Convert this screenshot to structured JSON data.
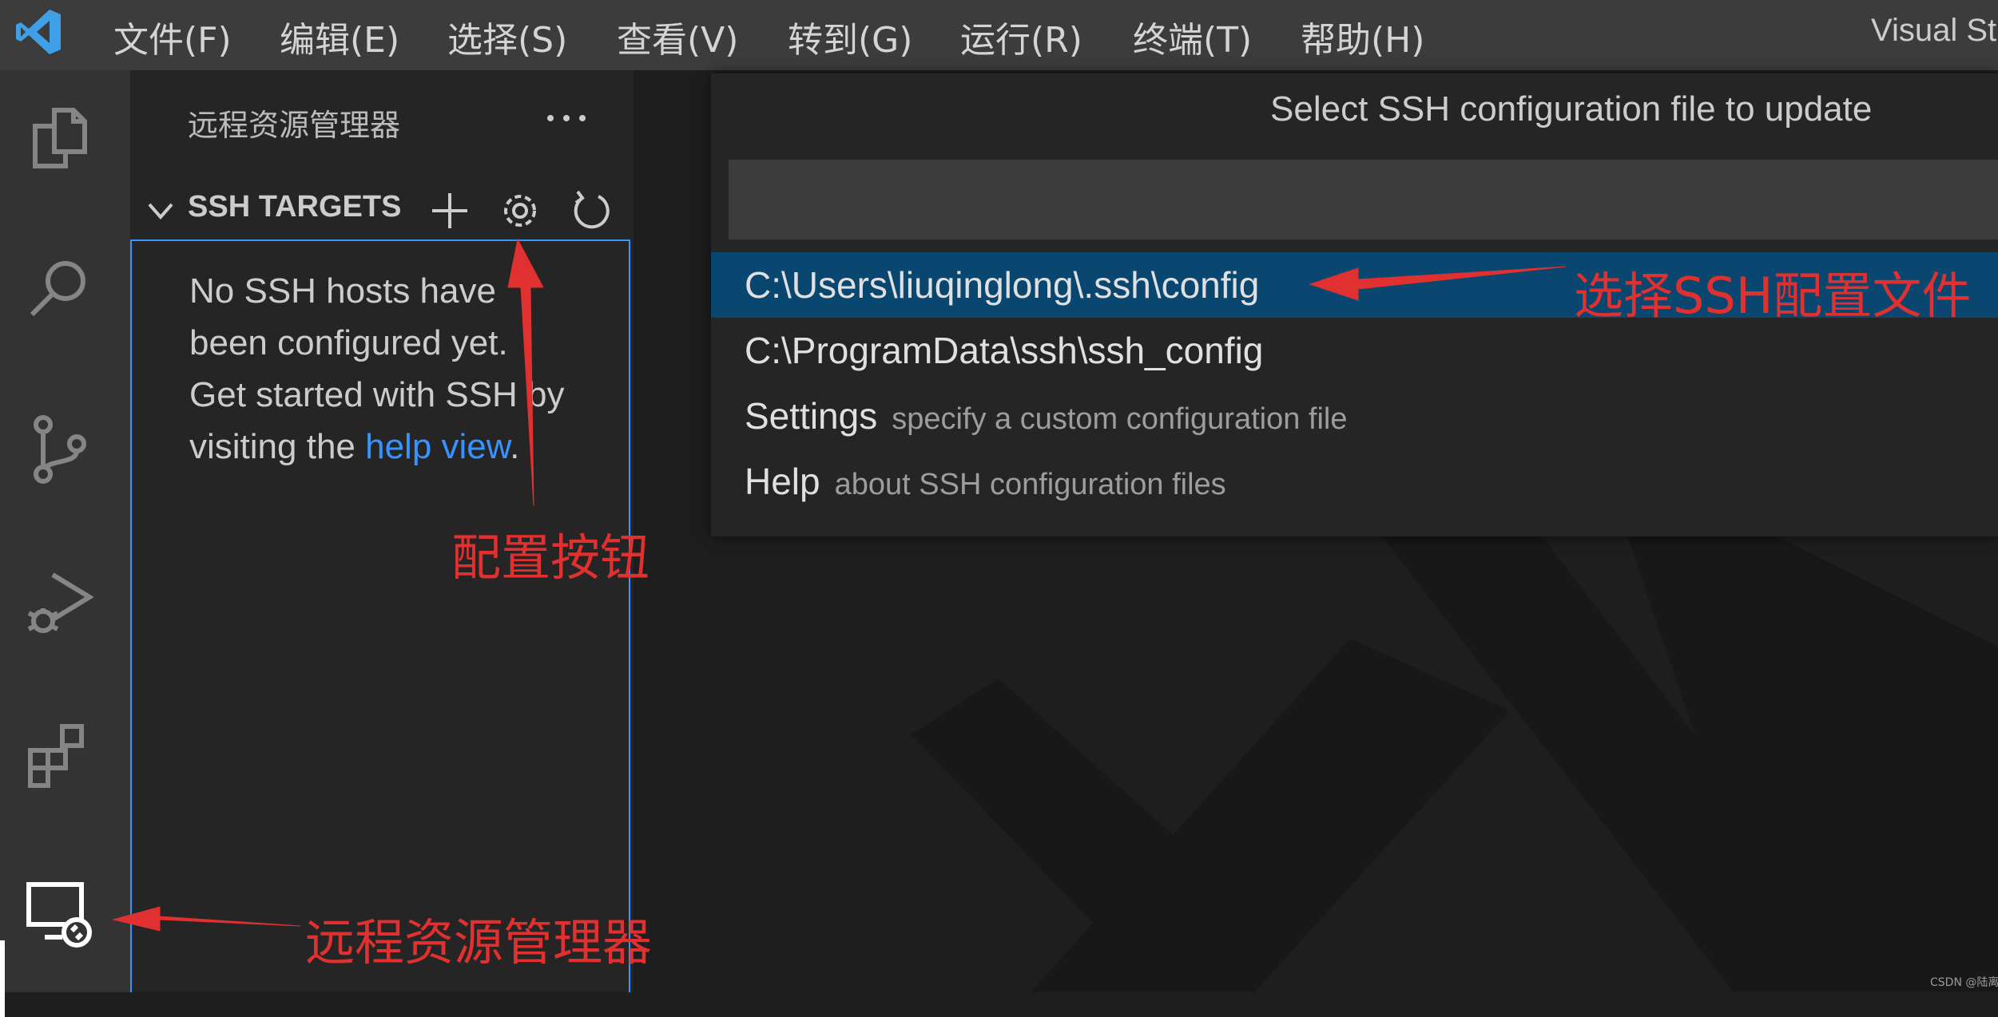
{
  "menubar": {
    "items": [
      "文件(F)",
      "编辑(E)",
      "选择(S)",
      "查看(V)",
      "转到(G)",
      "运行(R)",
      "终端(T)",
      "帮助(H)"
    ],
    "window_title": "Visual St"
  },
  "activitybar": {
    "icons": [
      "explorer-icon",
      "search-icon",
      "source-control-icon",
      "run-debug-icon",
      "extensions-icon",
      "remote-explorer-icon"
    ],
    "active": "remote-explorer-icon"
  },
  "sidebar": {
    "title": "远程资源管理器",
    "more_label": "···",
    "section": {
      "title": "SSH TARGETS",
      "actions": [
        "add-icon",
        "gear-icon",
        "refresh-icon"
      ]
    },
    "welcome": {
      "text": "No SSH hosts have been configured yet. Get started with SSH by visiting the ",
      "link": "help view",
      "suffix": "."
    }
  },
  "quickpick": {
    "title": "Select SSH configuration file to update",
    "input_value": "",
    "items": [
      {
        "label": "C:\\Users\\liuqinglong\\.ssh\\config",
        "description": "",
        "selected": true
      },
      {
        "label": "C:\\ProgramData\\ssh\\ssh_config",
        "description": "",
        "selected": false
      },
      {
        "label": "Settings",
        "description": "specify a custom configuration file",
        "selected": false
      },
      {
        "label": "Help",
        "description": "about SSH configuration files",
        "selected": false
      }
    ]
  },
  "annotations": {
    "gear_button": "配置按钮",
    "select_config": "选择SSH配置文件",
    "remote_explorer": "远程资源管理器",
    "color": "#e03030"
  },
  "credit": "CSDN @陆离"
}
